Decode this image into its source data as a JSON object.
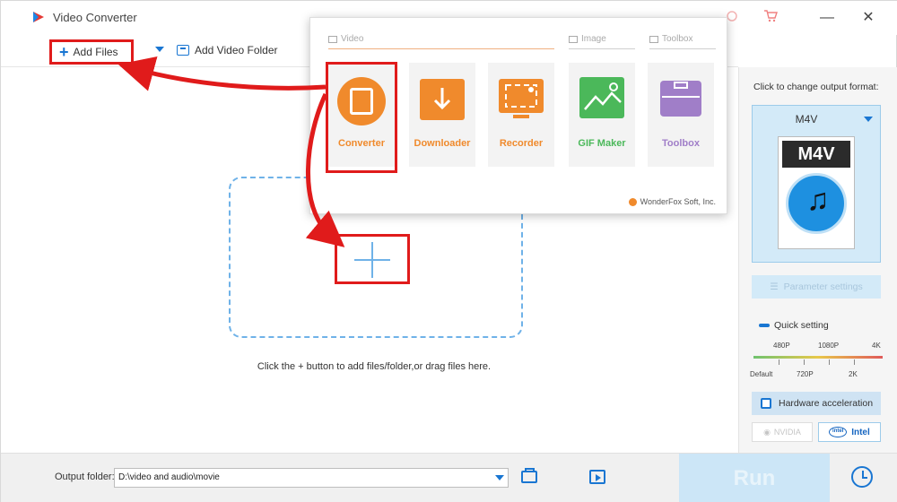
{
  "window": {
    "title": "Video Converter"
  },
  "toolbar": {
    "add_files_label": "Add Files",
    "add_folder_label": "Add Video Folder"
  },
  "main": {
    "hint": "Click the + button to add files/folder,or drag files here."
  },
  "launcher": {
    "sections": [
      {
        "label": "Video"
      },
      {
        "label": "Image"
      },
      {
        "label": "Toolbox"
      }
    ],
    "tiles": [
      {
        "label": "Converter",
        "color": "#f08a2c"
      },
      {
        "label": "Downloader",
        "color": "#f08a2c"
      },
      {
        "label": "Recorder",
        "color": "#f08a2c"
      },
      {
        "label": "GIF Maker",
        "color": "#4bb85a"
      },
      {
        "label": "Toolbox",
        "color": "#a07ec8"
      }
    ],
    "brand": "WonderFox Soft, Inc."
  },
  "output_panel": {
    "label": "Click to change output format:",
    "format": "M4V",
    "format_badge": "M4V",
    "parameter_settings": "Parameter settings",
    "quick_setting": "Quick setting",
    "quality_top": [
      "480P",
      "1080P",
      "4K"
    ],
    "quality_bottom": [
      "Default",
      "720P",
      "2K"
    ],
    "hardware_acceleration": "Hardware acceleration",
    "nvidia_label": "NVIDIA",
    "intel_label": "Intel",
    "intel_logo": "intel"
  },
  "bottom_bar": {
    "output_folder_label": "Output folder:",
    "output_folder_value": "D:\\video and audio\\movie",
    "run_label": "Run"
  },
  "colors": {
    "accent": "#1976d2",
    "highlight": "#e01b1b",
    "orange": "#f08a2c"
  }
}
